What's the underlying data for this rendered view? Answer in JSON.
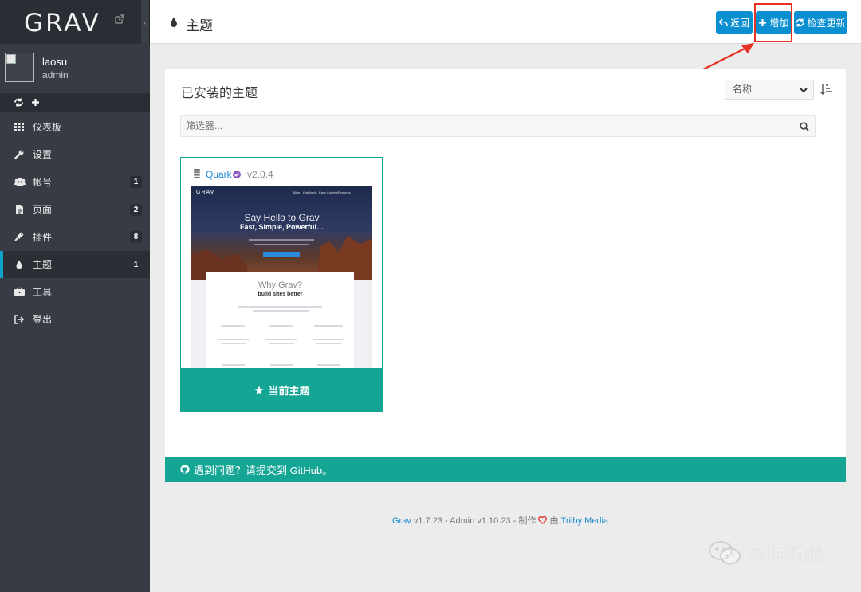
{
  "sidebar": {
    "logo": "GRAV",
    "user": {
      "name": "laosu",
      "role": "admin"
    },
    "items": [
      {
        "label": "仪表板",
        "icon": "dashboard-icon",
        "badge": ""
      },
      {
        "label": "设置",
        "icon": "wrench-icon",
        "badge": ""
      },
      {
        "label": "帐号",
        "icon": "users-icon",
        "badge": "1"
      },
      {
        "label": "页面",
        "icon": "file-icon",
        "badge": "2"
      },
      {
        "label": "插件",
        "icon": "plug-icon",
        "badge": "8"
      },
      {
        "label": "主题",
        "icon": "tint-icon",
        "badge": "1",
        "active": true
      },
      {
        "label": "工具",
        "icon": "briefcase-icon",
        "badge": ""
      },
      {
        "label": "登出",
        "icon": "sign-out-icon",
        "badge": ""
      }
    ]
  },
  "header": {
    "title": "主题",
    "buttons": {
      "back": "返回",
      "add": "增加",
      "update": "检查更新"
    }
  },
  "panel": {
    "title": "已安装的主题",
    "sort_value": "名称",
    "filter_placeholder": "筛选器..."
  },
  "theme": {
    "name": "Quark",
    "version": "v2.0.4",
    "action": "当前主题",
    "preview": {
      "logo": "GRAV",
      "nav": [
        "Blog",
        "Highlights",
        "Easy Content",
        "Features"
      ],
      "hero_title": "Say Hello to Grav",
      "hero_subtitle": "Fast, Simple, Powerful…",
      "section_title": "Why Grav?",
      "section_subtitle": "build sites better"
    }
  },
  "footer_bar": "遇到问题？请提交到 GitHub。",
  "credits": {
    "grav": "Grav",
    "rest1": " v1.7.23 - Admin v1.10.23 - 制作 ",
    "by": " 由 ",
    "trilby": "Trilby Media",
    "dot": "."
  },
  "watermark": "各种折腾",
  "colors": {
    "accent": "#14a595",
    "primary": "#0a8fd0",
    "sidebar": "#373b44",
    "annotation": "#e63022"
  }
}
